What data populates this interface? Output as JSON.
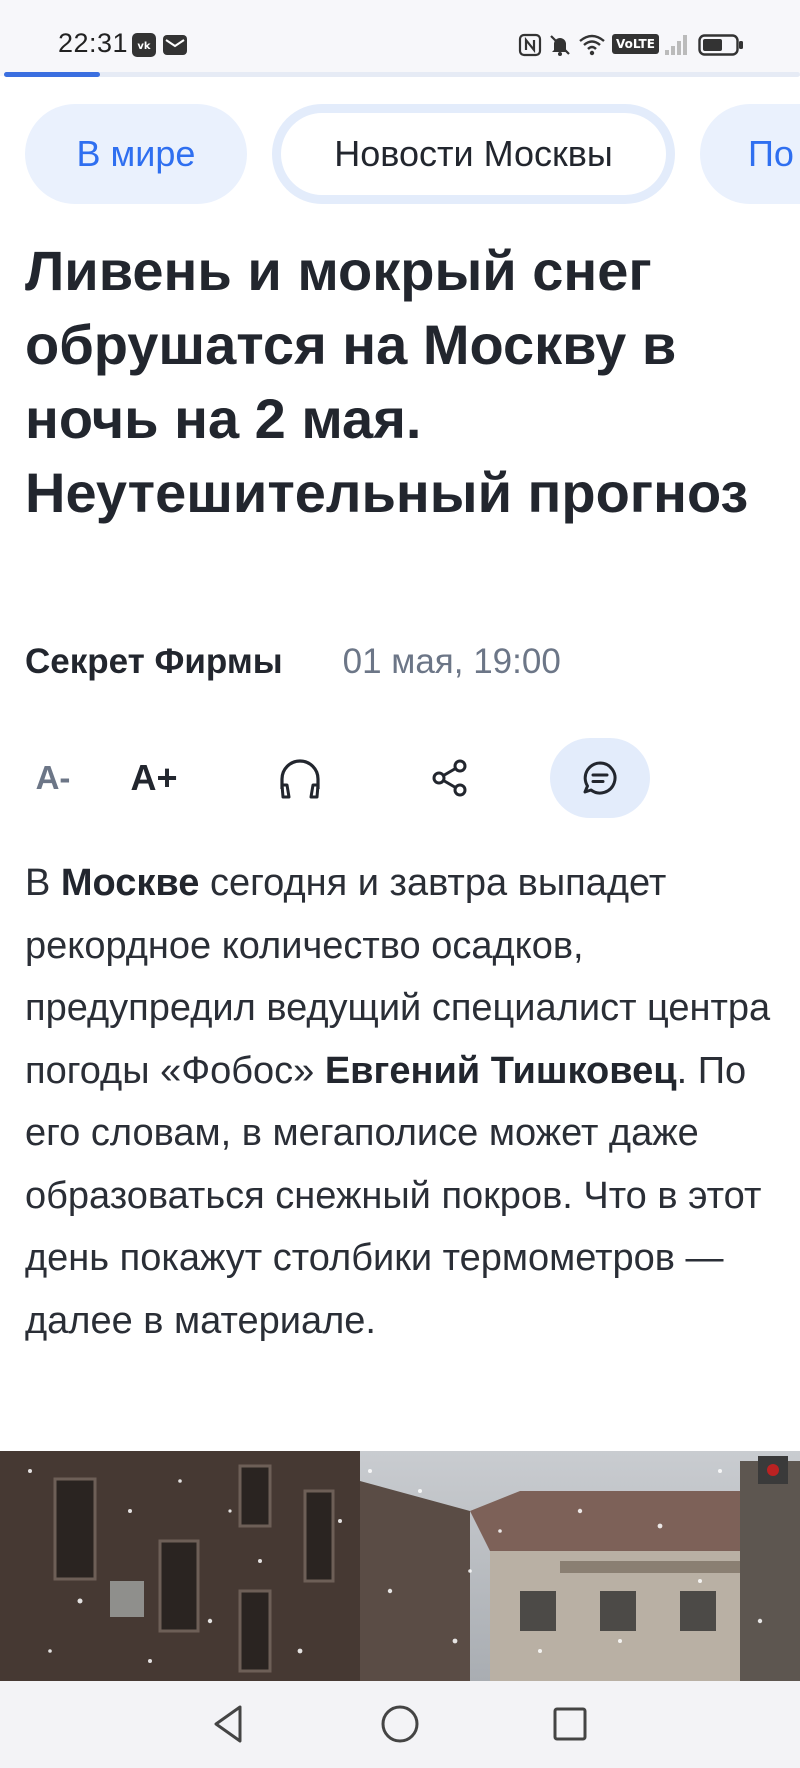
{
  "status": {
    "time": "22:31",
    "left_icons": [
      "vk-icon",
      "mail-icon"
    ],
    "right_icons": [
      "nfc-icon",
      "mute-icon",
      "wifi-icon",
      "volte-icon",
      "signal-icon",
      "battery-icon"
    ],
    "volte_label": "VoLTE"
  },
  "reading_progress": 0.12,
  "tabs": [
    {
      "label": "В мире",
      "active": false
    },
    {
      "label": "Новости Москвы",
      "active": true
    },
    {
      "label": "По",
      "active": false
    }
  ],
  "article": {
    "title": "Ливень и мокрый снег обрушатся на Москву в ночь на 2 мая. Неутешительный прогноз",
    "source": "Секрет Фирмы",
    "date": "01 мая, 19:00",
    "body": {
      "p1": "В ",
      "b1": "Москве",
      "p2": " сегодня и завтра выпадет рекордное количество осадков, предупредил ведущий специалист центра погоды «Фобос» ",
      "b2": "Евгений Тишковец",
      "p3": ". По его словам, в мегаполисе может даже образоваться снежный покров. Что в этот день покажут столбики термометров — далее в материале."
    }
  },
  "toolbar": {
    "font_decrease": "A-",
    "font_increase": "A+",
    "icons": [
      "headphones-icon",
      "share-icon",
      "comment-icon"
    ]
  },
  "colors": {
    "accent": "#2f6ff0",
    "tab_bg": "#eaf1fd",
    "progress": "#3b6fe0"
  }
}
